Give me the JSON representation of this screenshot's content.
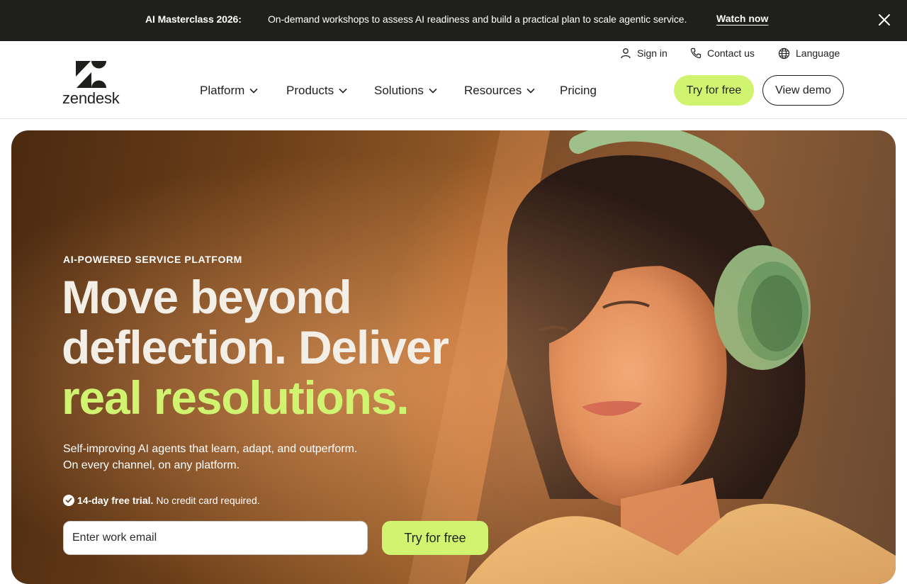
{
  "announcement": {
    "title": "AI Masterclass 2026:",
    "message": "On-demand workshops to assess AI readiness and build a practical plan to scale agentic service.",
    "link": "Watch now",
    "close_icon": "close-icon"
  },
  "header": {
    "logo_text": "zendesk",
    "utility": {
      "sign_in": "Sign in",
      "contact": "Contact us",
      "language": "Language"
    },
    "nav": [
      {
        "label": "Platform",
        "has_dropdown": true
      },
      {
        "label": "Products",
        "has_dropdown": true
      },
      {
        "label": "Solutions",
        "has_dropdown": true
      },
      {
        "label": "Resources",
        "has_dropdown": true
      },
      {
        "label": "Pricing",
        "has_dropdown": false
      }
    ],
    "cta_primary": "Try for free",
    "cta_secondary": "View demo"
  },
  "hero": {
    "eyebrow": "AI-POWERED SERVICE PLATFORM",
    "headline_line1": "Move beyond",
    "headline_line2": "deflection. Deliver",
    "headline_accent": "real resolutions.",
    "sub_line1": "Self-improving AI agents that learn, adapt, and outperform.",
    "sub_line2": "On every channel, on any platform.",
    "trial_bold": "14-day free trial.",
    "trial_rest": "No credit card required.",
    "email_placeholder": "Enter work email",
    "cta": "Try for free"
  },
  "colors": {
    "accent": "#d1f470",
    "dark": "#1f201c"
  }
}
